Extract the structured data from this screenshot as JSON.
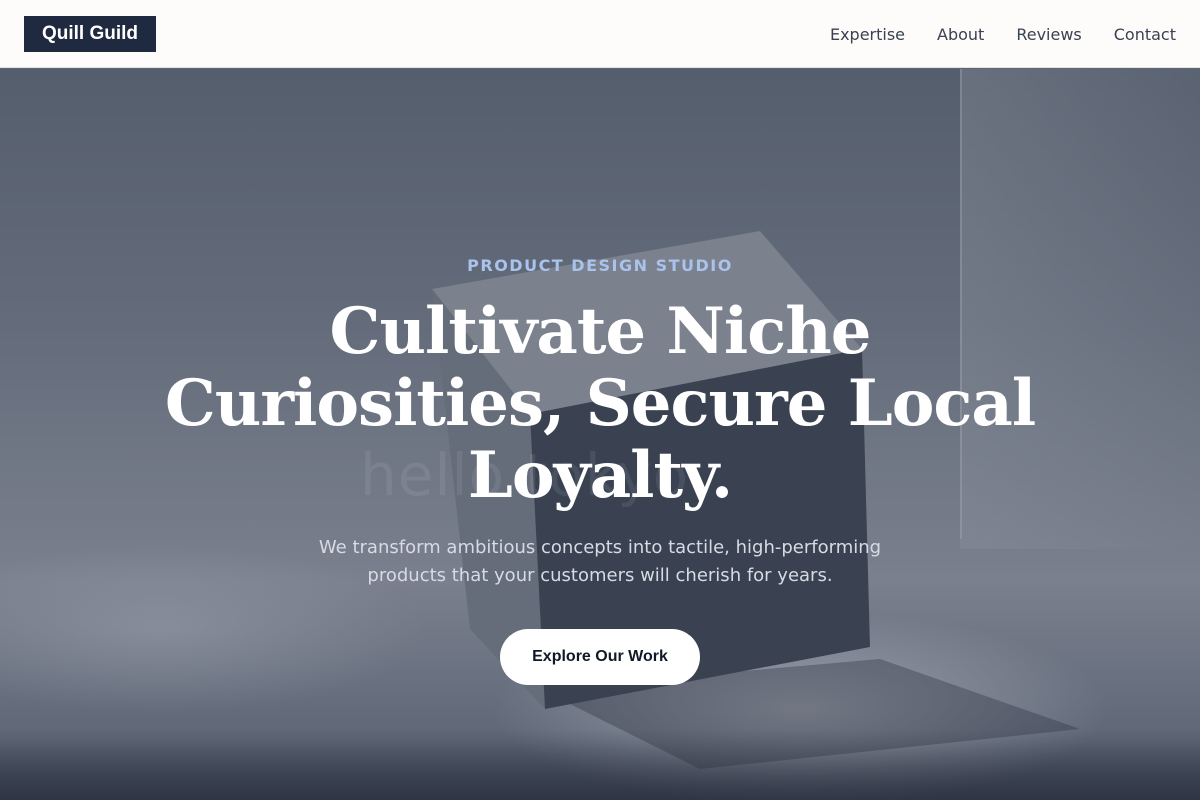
{
  "brand": {
    "name": "Quill Guild"
  },
  "nav": {
    "links": [
      {
        "label": "Expertise"
      },
      {
        "label": "About"
      },
      {
        "label": "Reviews"
      },
      {
        "label": "Contact"
      }
    ]
  },
  "hero": {
    "background_image_watermark": "hello tokyo",
    "kicker": "PRODUCT DESIGN STUDIO",
    "headline": "Cultivate Niche Curiosities, Secure Local Loyalty.",
    "subtext": "We transform ambitious concepts into tactile, high-performing products that your customers will cherish for years.",
    "cta_label": "Explore Our Work"
  },
  "colors": {
    "brand_bg": "#1f2a40",
    "kicker": "#a9c3ec",
    "nav_text": "#394152",
    "cta_bg": "#ffffff",
    "cta_text": "#111827"
  }
}
